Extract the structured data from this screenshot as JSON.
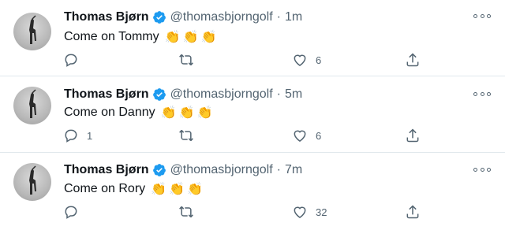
{
  "tweets": [
    {
      "name": "Thomas Bjørn",
      "handle": "@thomasbjorngolf",
      "separator": "·",
      "time": "1m",
      "text": "Come on Tommy",
      "claps": [
        "👏",
        "👏",
        "👏"
      ],
      "reply_count": "",
      "retweet_count": "",
      "like_count": "6"
    },
    {
      "name": "Thomas Bjørn",
      "handle": "@thomasbjorngolf",
      "separator": "·",
      "time": "5m",
      "text": "Come on Danny",
      "claps": [
        "👏",
        "👏",
        "👏"
      ],
      "reply_count": "1",
      "retweet_count": "",
      "like_count": "6"
    },
    {
      "name": "Thomas Bjørn",
      "handle": "@thomasbjorngolf",
      "separator": "·",
      "time": "7m",
      "text": "Come on Rory",
      "claps": [
        "👏",
        "👏",
        "👏"
      ],
      "reply_count": "",
      "retweet_count": "",
      "like_count": "32"
    }
  ],
  "icons": {
    "verified": "verified-badge-icon",
    "reply": "reply-icon",
    "retweet": "retweet-icon",
    "like": "heart-icon",
    "share": "share-icon",
    "more": "more-icon"
  },
  "colors": {
    "verified": "#1d9bf0",
    "icon": "#536471",
    "divider": "#e1e8ed"
  }
}
